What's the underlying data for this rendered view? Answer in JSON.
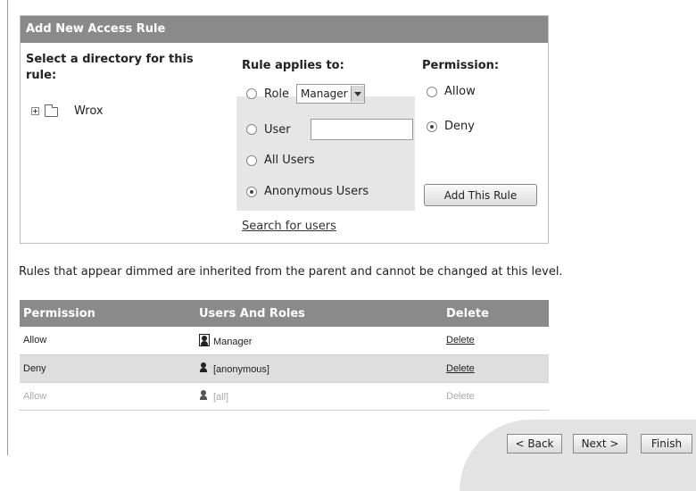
{
  "panel": {
    "title": "Add New Access Rule",
    "directory_heading": "Select a directory for this rule:",
    "tree_folder": "Wrox",
    "rule_heading": "Rule applies to:",
    "permission_heading": "Permission:",
    "options": {
      "role": "Role",
      "role_selected": "Manager",
      "user": "User",
      "user_value": "",
      "all_users": "All Users",
      "anonymous": "Anonymous Users",
      "selected": "anonymous"
    },
    "permission": {
      "allow": "Allow",
      "deny": "Deny",
      "selected": "deny"
    },
    "search_link": "Search for users",
    "add_button": "Add This Rule"
  },
  "notice": "Rules that appear dimmed are inherited from the parent and cannot be changed at this level.",
  "rules_table": {
    "headers": [
      "Permission",
      "Users And Roles",
      "Delete"
    ],
    "rows": [
      {
        "permission": "Allow",
        "user": "Manager",
        "delete": "Delete",
        "icon": "role-icon",
        "dimmed": false
      },
      {
        "permission": "Deny",
        "user": "[anonymous]",
        "delete": "Delete",
        "icon": "user-icon",
        "dimmed": false
      },
      {
        "permission": "Allow",
        "user": "[all]",
        "delete": "Delete",
        "icon": "user-icon",
        "dimmed": true
      }
    ]
  },
  "wizard": {
    "back": "< Back",
    "next": "Next >",
    "finish": "Finish"
  }
}
